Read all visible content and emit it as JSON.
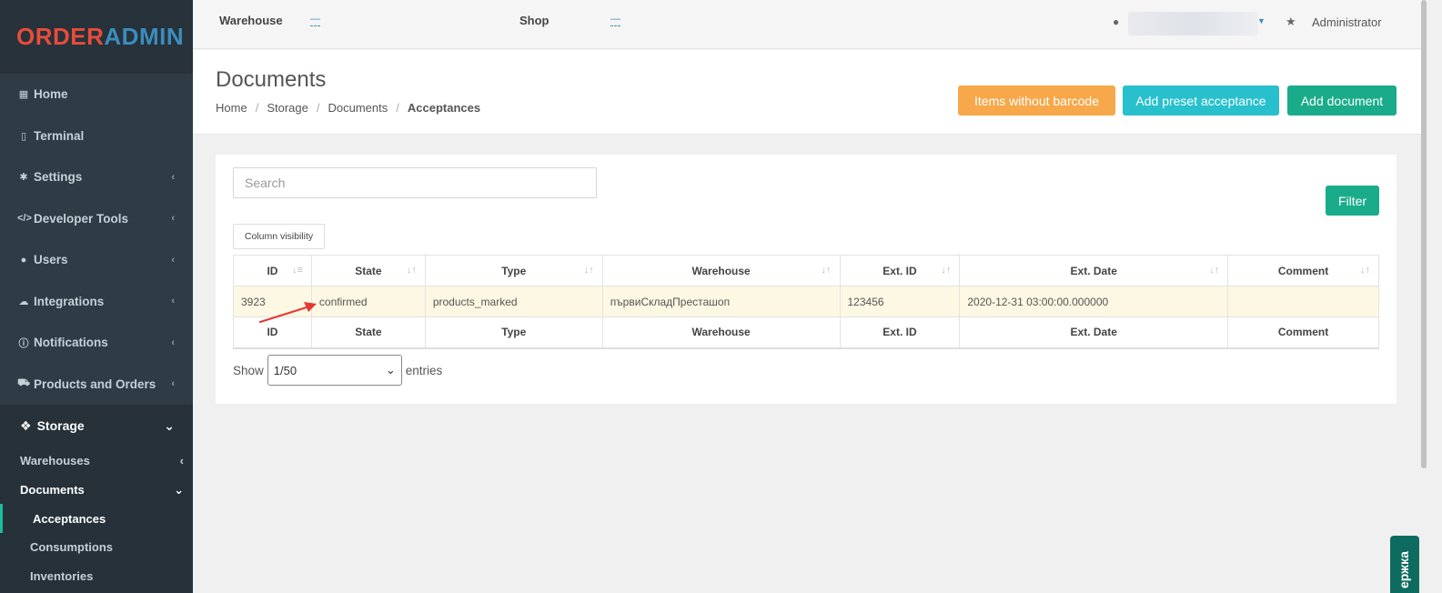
{
  "brand": {
    "part1": "ORDER",
    "part2": "ADMIN"
  },
  "sidebar": {
    "items": [
      {
        "label": "Home",
        "icon": "grid-icon"
      },
      {
        "label": "Terminal",
        "icon": "tablet-icon"
      },
      {
        "label": "Settings",
        "icon": "gear-icon"
      },
      {
        "label": "Developer Tools",
        "icon": "code-icon"
      },
      {
        "label": "Users",
        "icon": "user-icon"
      },
      {
        "label": "Integrations",
        "icon": "cloud-icon"
      },
      {
        "label": "Notifications",
        "icon": "info-icon"
      },
      {
        "label": "Products and Orders",
        "icon": "cart-icon"
      }
    ],
    "storage": {
      "label": "Storage",
      "icon": "cubes-icon"
    },
    "sub_items": {
      "warehouses": "Warehouses",
      "documents": "Documents",
      "acceptances": "Acceptances",
      "consumptions": "Consumptions",
      "inventories": "Inventories"
    }
  },
  "topbar": {
    "warehouse_label": "Warehouse",
    "warehouse_value": "—",
    "shop_label": "Shop",
    "shop_value": "—",
    "role": "Administrator"
  },
  "header": {
    "title": "Documents",
    "breadcrumb": [
      "Home",
      "Storage",
      "Documents",
      "Acceptances"
    ],
    "buttons": {
      "items_without_barcode": "Items without barcode",
      "add_preset": "Add preset acceptance",
      "add_document": "Add document"
    }
  },
  "panel": {
    "search_placeholder": "Search",
    "filter_label": "Filter",
    "column_visibility": "Column visibility",
    "columns": [
      "ID",
      "State",
      "Type",
      "Warehouse",
      "Ext. ID",
      "Ext. Date",
      "Comment"
    ],
    "rows": [
      [
        "3923",
        "confirmed",
        "products_marked",
        "първиСкладПреста, шоп",
        "123456",
        "2020-12-31 03:00:00.000000",
        ""
      ]
    ],
    "show_label": "Show",
    "page_size": "1/50",
    "entries_label": "entries"
  },
  "support_tab": "ержка",
  "colors": {
    "orange": "#f6a84a",
    "cyan": "#27c0cc",
    "green": "#1aab8a",
    "sidebar": "#2f3b45"
  }
}
